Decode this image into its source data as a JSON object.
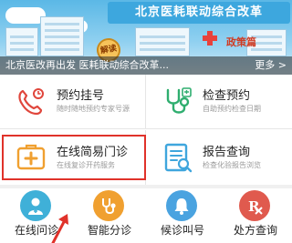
{
  "banner": {
    "headline": "北京医耗联动综合改革",
    "tag": "政策篇",
    "sign": "解读",
    "caption": "北京医改再出发 医耗联动综合改革...",
    "more_label": "更多 >"
  },
  "services": [
    {
      "title": "预约挂号",
      "subtitle": "随时随地预约专家号源",
      "icon": "phone-hand-icon"
    },
    {
      "title": "检查预约",
      "subtitle": "自助预约检查日期",
      "icon": "stethoscope-icon"
    },
    {
      "title": "在线简易门诊",
      "subtitle": "在线复诊开药服务",
      "icon": "medicine-box-icon"
    },
    {
      "title": "报告查询",
      "subtitle": "检查化验报告浏览",
      "icon": "report-icon"
    }
  ],
  "bottom_nav": [
    {
      "label": "在线问诊",
      "icon": "doctor-icon",
      "color": "#3fb0d8"
    },
    {
      "label": "智能分诊",
      "icon": "stethoscope-icon",
      "color": "#f0a030"
    },
    {
      "label": "候诊叫号",
      "icon": "bell-icon",
      "color": "#4aa3e0"
    },
    {
      "label": "处方查询",
      "icon": "rx-icon",
      "color": "#e05a4e"
    }
  ],
  "colors": {
    "accent_red": "#e0322a",
    "icon_red": "#e0463c",
    "icon_green": "#2fae6f",
    "icon_orange": "#f0a030",
    "icon_blue": "#3fa6dd"
  }
}
